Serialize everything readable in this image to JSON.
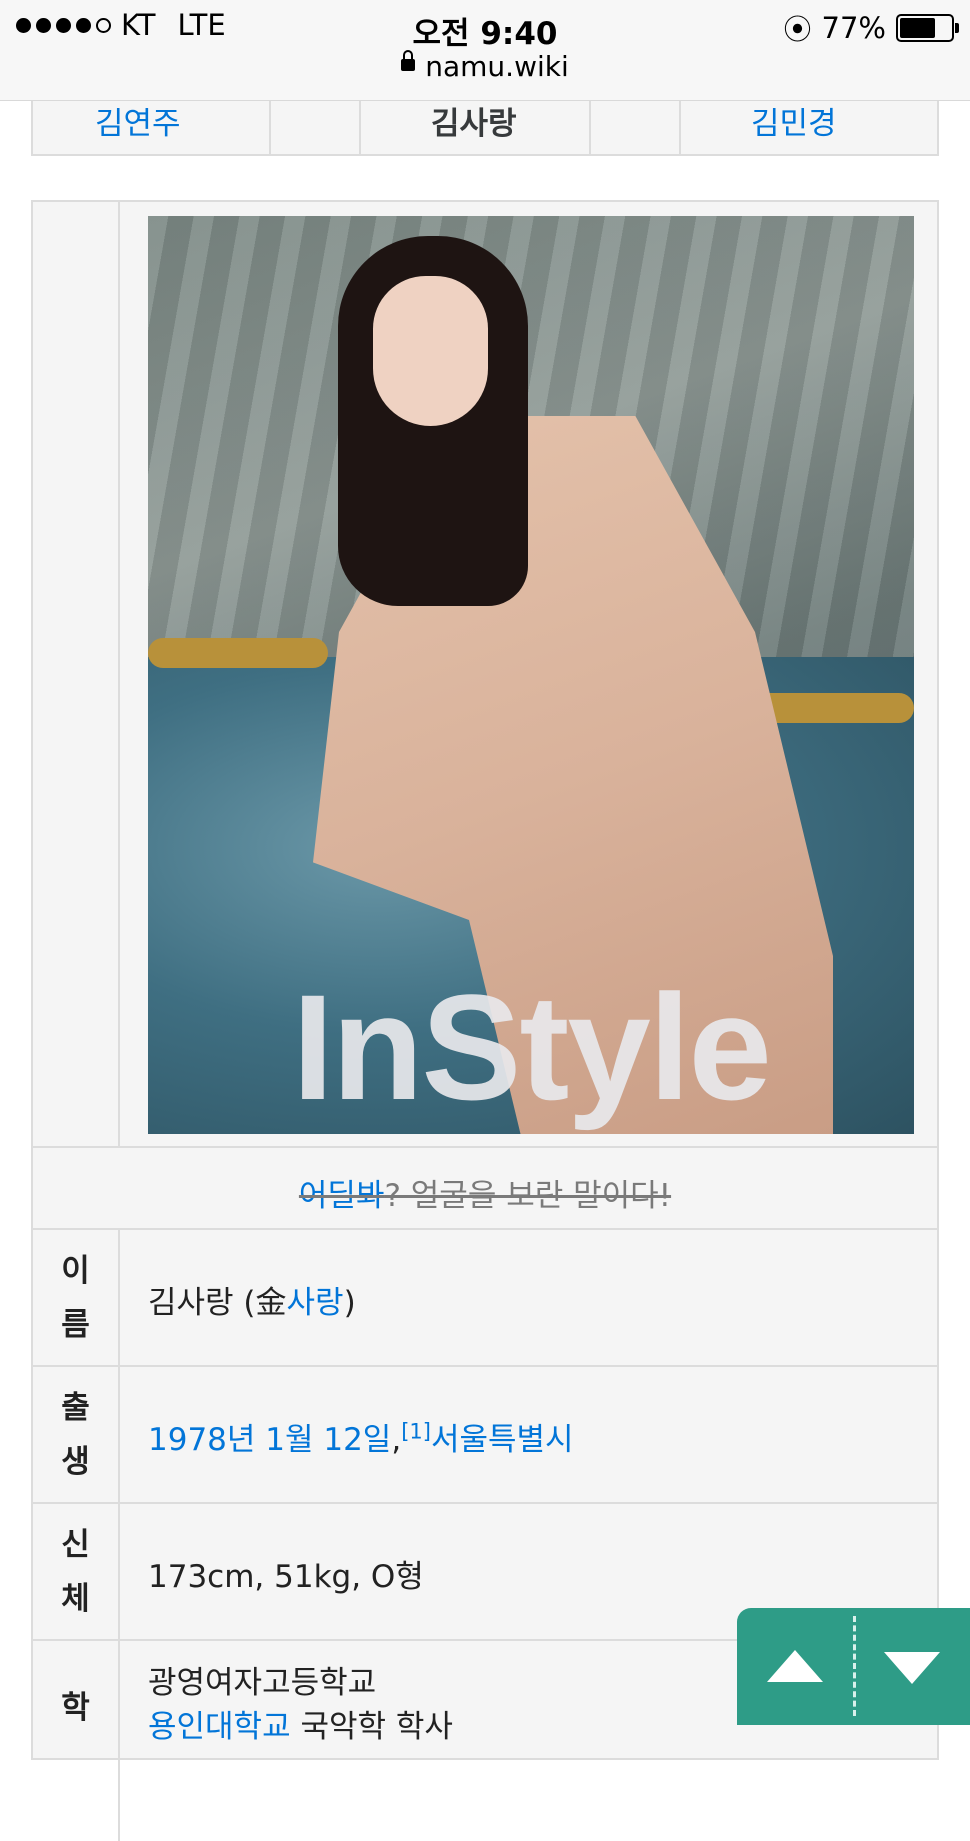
{
  "status_bar": {
    "carrier": "KT",
    "network": "LTE",
    "time": "오전 9:40",
    "battery_percent": "77%",
    "battery_level": 0.77
  },
  "browser": {
    "url": "namu.wiki"
  },
  "nav_strip": {
    "left": "김연주",
    "center": "김사랑",
    "right": "김민경"
  },
  "infobox": {
    "photo_brand": "InStyle",
    "caption": "어딜봐? 얼굴을 보란 말이다!",
    "caption_link": "어딜봐",
    "caption_rest": "? 얼굴을 보란 말이다!",
    "rows": [
      {
        "label_1": "이",
        "label_2": "름",
        "value_prefix": "김사랑 (金",
        "value_link": "사랑",
        "value_suffix": ")"
      },
      {
        "label_1": "출",
        "label_2": "생",
        "value_link": "1978년 1월 12일",
        "value_mid": ",",
        "footnote": "[1]",
        "value_link2": "서울특별시"
      },
      {
        "label_1": "신",
        "label_2": "체",
        "value": "173cm, 51kg, O형"
      },
      {
        "label_1": "학",
        "value_line1": "광영여자고등학교",
        "value_line2_link": "용인대학교",
        "value_line2": " 국악학 학사"
      }
    ]
  },
  "scroll_buttons": {
    "up_icon": "arrow-up-icon",
    "down_icon": "arrow-down-icon"
  },
  "colors": {
    "link": "#0275d8",
    "scroll_button_bg": "#2e9c87"
  }
}
